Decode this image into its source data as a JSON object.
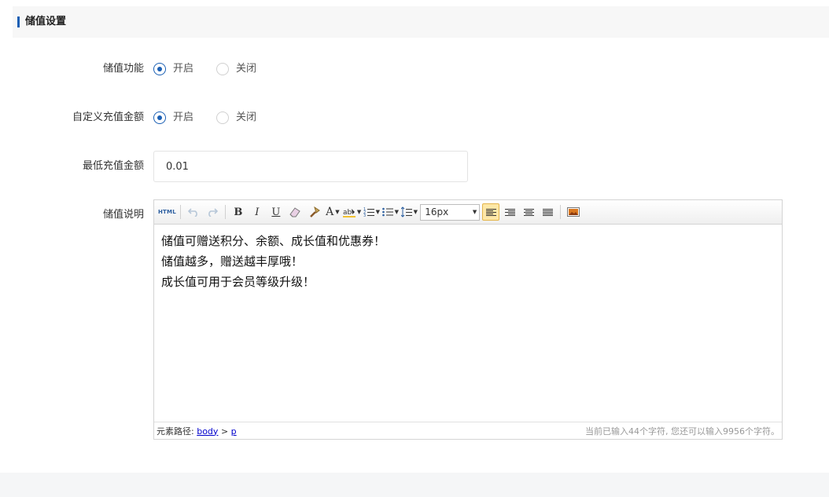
{
  "section": {
    "title": "储值设置"
  },
  "rows": {
    "recharge_enable": {
      "label": "储值功能",
      "options": [
        "开启",
        "关闭"
      ],
      "selected": "开启"
    },
    "custom_amount": {
      "label": "自定义充值金额",
      "options": [
        "开启",
        "关闭"
      ],
      "selected": "开启"
    },
    "min_amount": {
      "label": "最低充值金额",
      "value": "0.01"
    },
    "description": {
      "label": "储值说明"
    }
  },
  "editor": {
    "toolbar": {
      "html_label": "HTML",
      "bold": "B",
      "italic": "I",
      "underline": "U",
      "font_color": "A",
      "font_size": "16px"
    },
    "content_lines": [
      "储值可赠送积分、余额、成长值和优惠券！",
      "储值越多，赠送越丰厚哦！",
      "成长值可用于会员等级升级！"
    ],
    "status": {
      "path_label": "元素路径:",
      "path_body": "body",
      "path_sep": ">",
      "path_p": "p",
      "char_count": "当前已输入44个字符, 您还可以输入9956个字符。"
    }
  },
  "colors": {
    "accent": "#1a5fb4",
    "active_align_bg": "#fde7a6"
  }
}
